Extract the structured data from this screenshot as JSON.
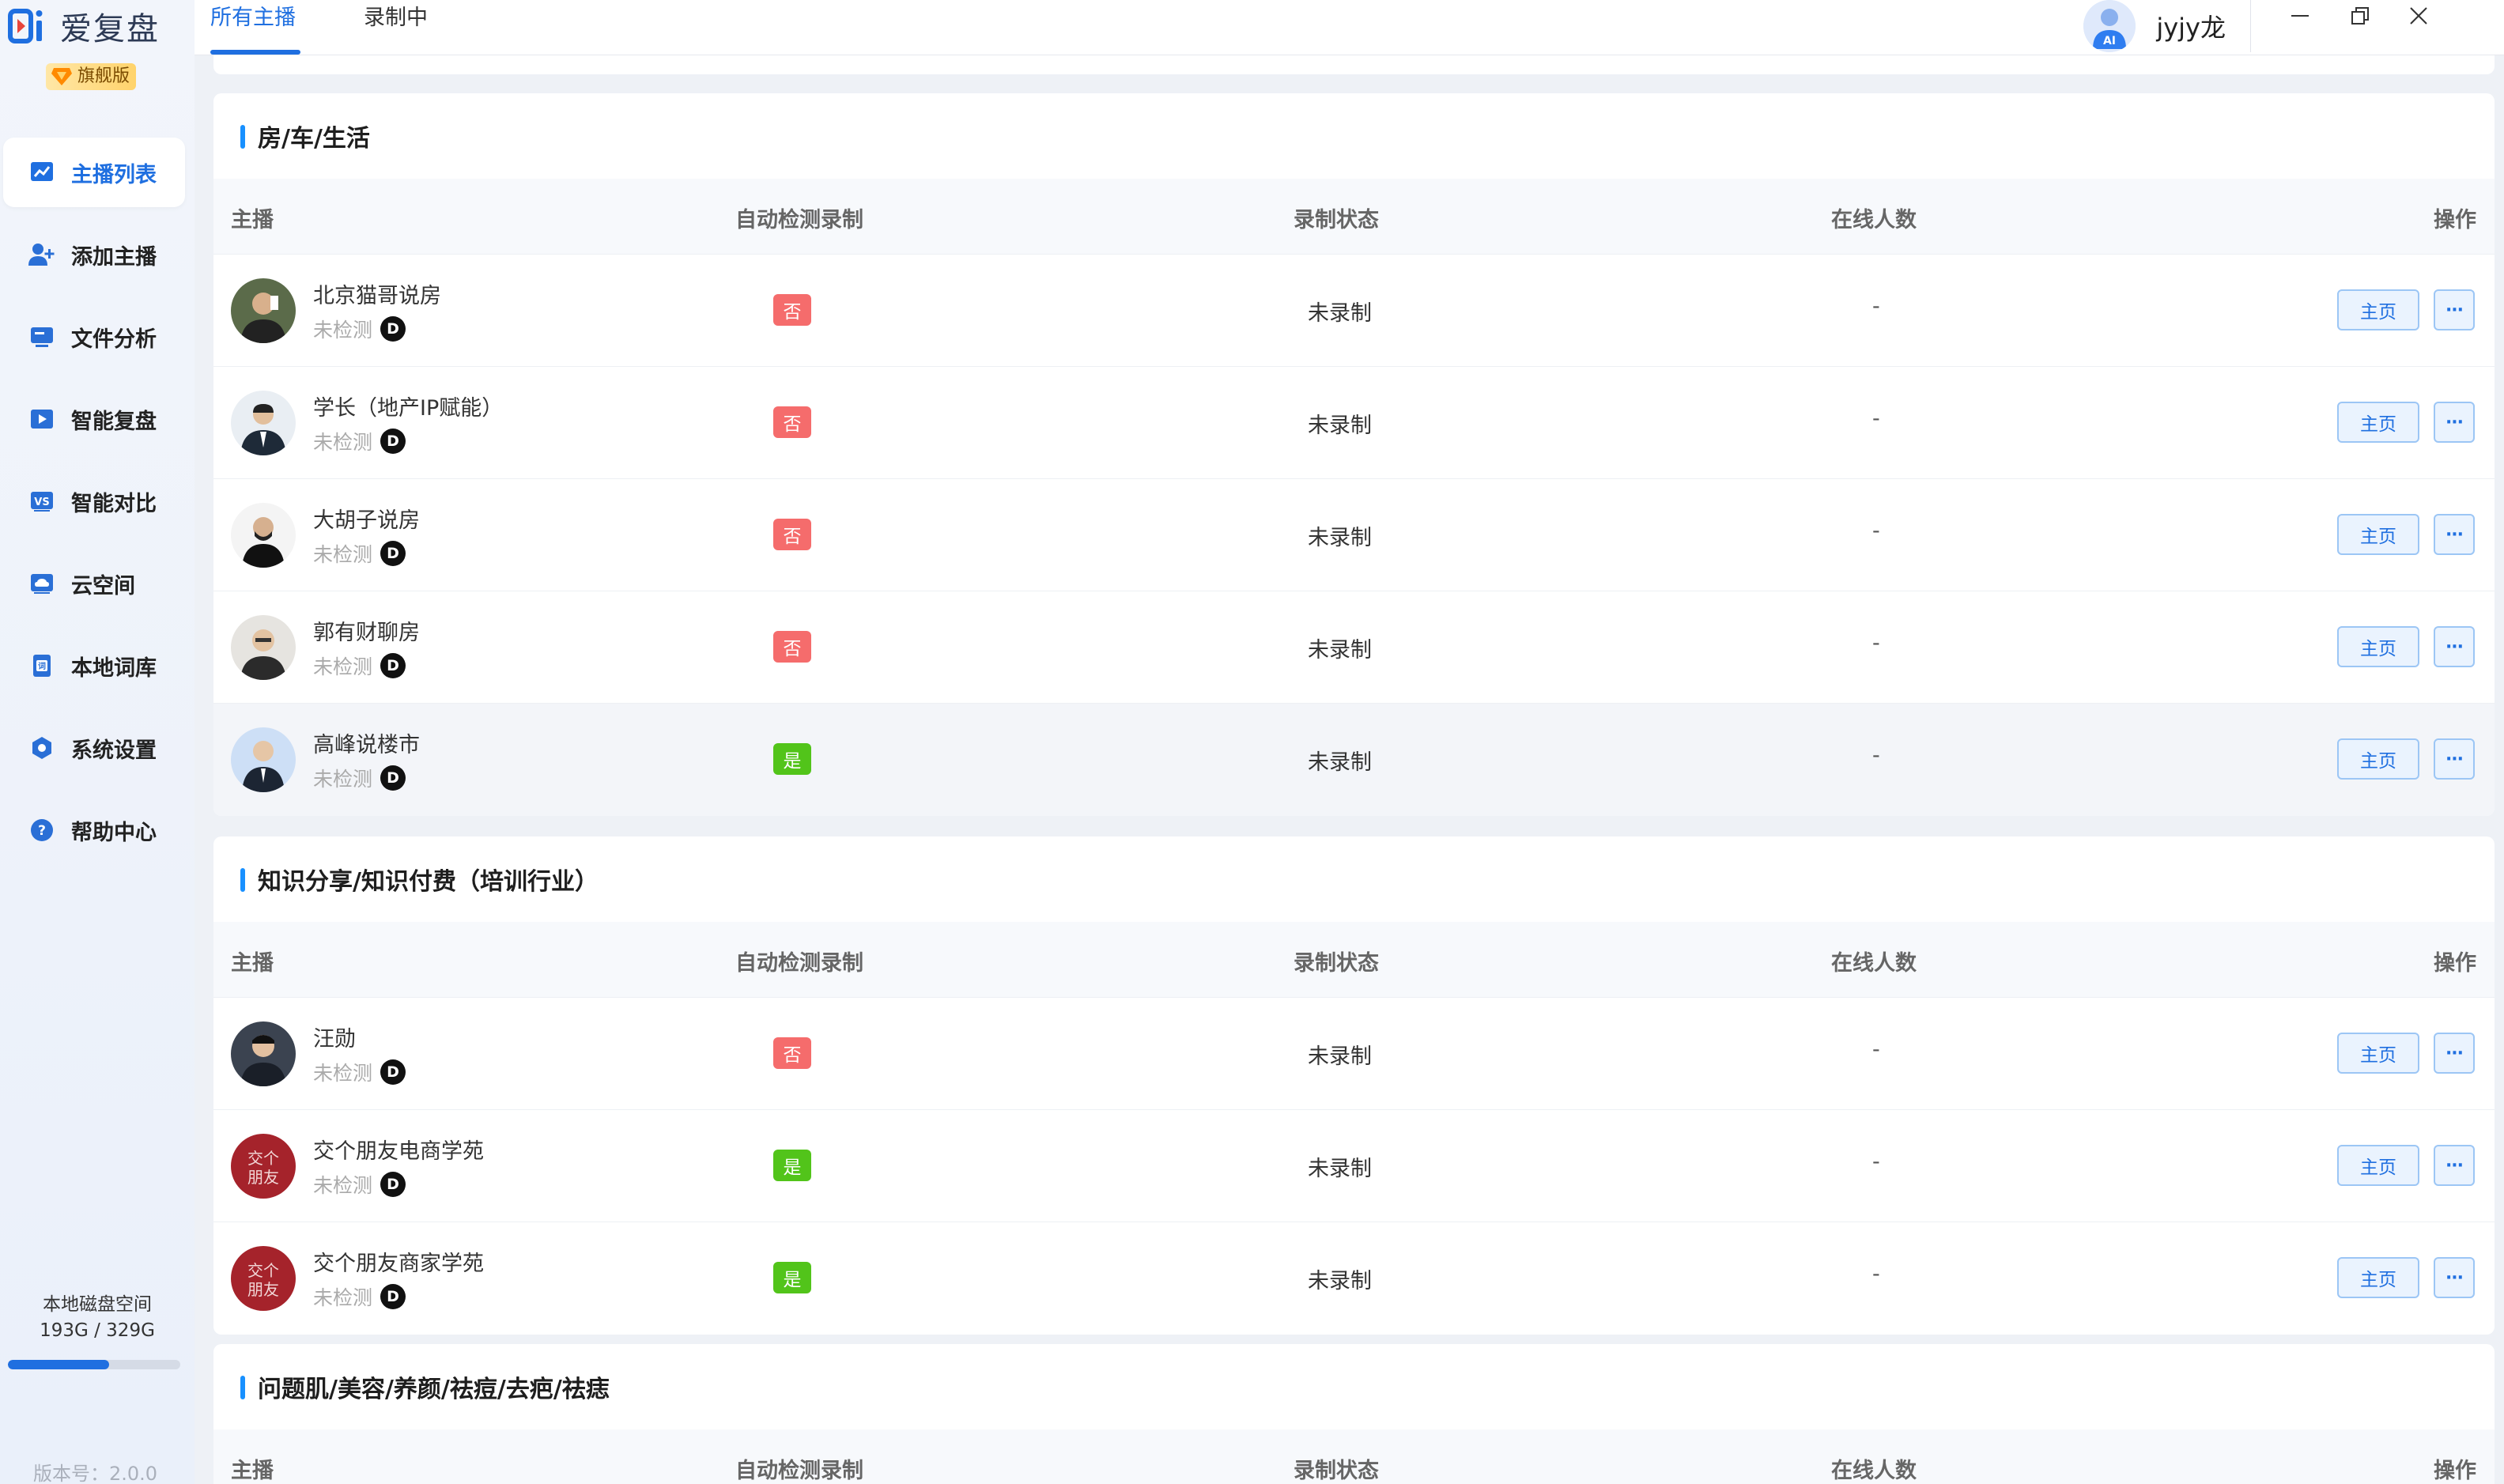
{
  "app": {
    "name": "爱复盘",
    "edition": "旗舰版"
  },
  "sidebar": {
    "items": [
      {
        "label": "主播列表",
        "icon": "chart-icon",
        "active": true
      },
      {
        "label": "添加主播",
        "icon": "add-user-icon"
      },
      {
        "label": "文件分析",
        "icon": "file-analysis-icon"
      },
      {
        "label": "智能复盘",
        "icon": "play-icon"
      },
      {
        "label": "智能对比",
        "icon": "vs-icon"
      },
      {
        "label": "云空间",
        "icon": "cloud-icon"
      },
      {
        "label": "本地词库",
        "icon": "dictionary-icon"
      },
      {
        "label": "系统设置",
        "icon": "gear-icon"
      },
      {
        "label": "帮助中心",
        "icon": "help-icon"
      }
    ],
    "disk": {
      "label": "本地磁盘空间",
      "usage": "193G / 329G",
      "used_fraction": 0.587
    },
    "version": "版本号：2.0.0"
  },
  "topbar": {
    "tabs": [
      {
        "label": "所有主播",
        "active": true
      },
      {
        "label": "录制中"
      }
    ],
    "avatar_badge": "AI",
    "username": "jyjy龙"
  },
  "columns": {
    "host": "主播",
    "auto": "自动检测录制",
    "status": "录制状态",
    "online": "在线人数",
    "actions": "操作"
  },
  "buttons": {
    "home": "主页",
    "more": "···"
  },
  "platform_badge": "D",
  "sections": [
    {
      "title": "房/车/生活",
      "rows": [
        {
          "name": "北京猫哥说房",
          "sub": "未检测",
          "auto": "否",
          "status": "未录制",
          "online": "-"
        },
        {
          "name": "学长（地产IP赋能）",
          "sub": "未检测",
          "auto": "否",
          "status": "未录制",
          "online": "-"
        },
        {
          "name": "大胡子说房",
          "sub": "未检测",
          "auto": "否",
          "status": "未录制",
          "online": "-"
        },
        {
          "name": "郭有财聊房",
          "sub": "未检测",
          "auto": "否",
          "status": "未录制",
          "online": "-"
        },
        {
          "name": "高峰说楼市",
          "sub": "未检测",
          "auto": "是",
          "status": "未录制",
          "online": "-"
        }
      ]
    },
    {
      "title": "知识分享/知识付费（培训行业）",
      "rows": [
        {
          "name": "汪勋",
          "sub": "未检测",
          "auto": "否",
          "status": "未录制",
          "online": "-"
        },
        {
          "name": "交个朋友电商学苑",
          "sub": "未检测",
          "auto": "是",
          "status": "未录制",
          "online": "-"
        },
        {
          "name": "交个朋友商家学苑",
          "sub": "未检测",
          "auto": "是",
          "status": "未录制",
          "online": "-"
        }
      ]
    },
    {
      "title": "问题肌/美容/养颜/祛痘/去疤/祛痣",
      "rows": []
    }
  ],
  "colors": {
    "accent": "#1f6fe0",
    "no": "#f56c6c",
    "yes": "#52c41a"
  }
}
